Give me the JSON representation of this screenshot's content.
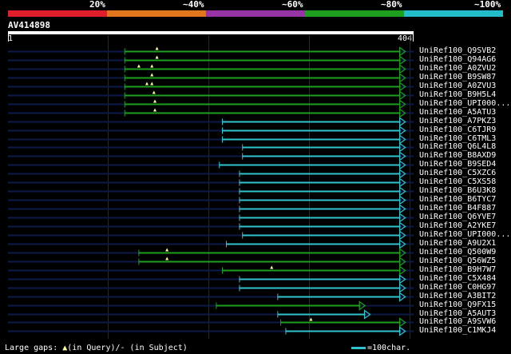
{
  "legend": {
    "labels": [
      "20%",
      "~40%",
      "~60%",
      "~80%",
      "~100%"
    ],
    "colors": [
      "#e01e2c",
      "#e2761f",
      "#9634a6",
      "#1e9e1e",
      "#24bcc8"
    ]
  },
  "query": {
    "name": "AV414898",
    "start_label": "1",
    "end_label": "404",
    "length": 404
  },
  "colors": {
    "green": "#1e9e1e",
    "cyan": "#2fc3d0",
    "gap_marker": "#ffff99",
    "background_line": "#0c1a4a"
  },
  "hits": [
    {
      "label": "UniRef100_Q9SVB2",
      "start": 117,
      "end": 391,
      "color": "green",
      "gaps": [
        149
      ]
    },
    {
      "label": "UniRef100_Q94AG6",
      "start": 117,
      "end": 391,
      "color": "green",
      "gaps": [
        149
      ]
    },
    {
      "label": "UniRef100_A0ZVU2",
      "start": 117,
      "end": 391,
      "color": "green",
      "gaps": [
        131,
        144
      ]
    },
    {
      "label": "UniRef100_B9SW87",
      "start": 117,
      "end": 391,
      "color": "green",
      "gaps": [
        144
      ]
    },
    {
      "label": "UniRef100_A0ZVU3",
      "start": 117,
      "end": 391,
      "color": "green",
      "gaps": [
        139,
        144
      ]
    },
    {
      "label": "UniRef100_B9H5L4",
      "start": 117,
      "end": 391,
      "color": "green",
      "gaps": [
        146
      ]
    },
    {
      "label": "UniRef100_UPI000...",
      "start": 117,
      "end": 391,
      "color": "green",
      "gaps": [
        147
      ]
    },
    {
      "label": "UniRef100_A5ATU3",
      "start": 117,
      "end": 391,
      "color": "green",
      "gaps": [
        147
      ]
    },
    {
      "label": "UniRef100_A7PKZ3",
      "start": 214,
      "end": 391,
      "color": "cyan",
      "gaps": []
    },
    {
      "label": "UniRef100_C6TJR9",
      "start": 214,
      "end": 391,
      "color": "cyan",
      "gaps": []
    },
    {
      "label": "UniRef100_C6TML3",
      "start": 214,
      "end": 391,
      "color": "cyan",
      "gaps": []
    },
    {
      "label": "UniRef100_Q6L4L8",
      "start": 234,
      "end": 391,
      "color": "cyan",
      "gaps": []
    },
    {
      "label": "UniRef100_B8AXD9",
      "start": 234,
      "end": 391,
      "color": "cyan",
      "gaps": []
    },
    {
      "label": "UniRef100_B9SED4",
      "start": 211,
      "end": 391,
      "color": "cyan",
      "gaps": []
    },
    {
      "label": "UniRef100_C5XZC6",
      "start": 231,
      "end": 391,
      "color": "cyan",
      "gaps": []
    },
    {
      "label": "UniRef100_C5XS58",
      "start": 231,
      "end": 391,
      "color": "cyan",
      "gaps": []
    },
    {
      "label": "UniRef100_B6U3K8",
      "start": 231,
      "end": 391,
      "color": "cyan",
      "gaps": []
    },
    {
      "label": "UniRef100_B6TYC7",
      "start": 231,
      "end": 391,
      "color": "cyan",
      "gaps": []
    },
    {
      "label": "UniRef100_B4F887",
      "start": 231,
      "end": 391,
      "color": "cyan",
      "gaps": []
    },
    {
      "label": "UniRef100_Q6YVE7",
      "start": 231,
      "end": 391,
      "color": "cyan",
      "gaps": []
    },
    {
      "label": "UniRef100_A2YKE7",
      "start": 231,
      "end": 391,
      "color": "cyan",
      "gaps": []
    },
    {
      "label": "UniRef100_UPI000...",
      "start": 234,
      "end": 391,
      "color": "cyan",
      "gaps": []
    },
    {
      "label": "UniRef100_A9U2X1",
      "start": 218,
      "end": 391,
      "color": "cyan",
      "gaps": []
    },
    {
      "label": "UniRef100_Q500W9",
      "start": 131,
      "end": 391,
      "color": "green",
      "gaps": [
        159
      ]
    },
    {
      "label": "UniRef100_Q56WZ5",
      "start": 131,
      "end": 391,
      "color": "green",
      "gaps": [
        159
      ]
    },
    {
      "label": "UniRef100_B9H7W7",
      "start": 214,
      "end": 391,
      "color": "green",
      "gaps": [
        263
      ]
    },
    {
      "label": "UniRef100_C5X484",
      "start": 231,
      "end": 391,
      "color": "cyan",
      "gaps": []
    },
    {
      "label": "UniRef100_C0HG97",
      "start": 231,
      "end": 391,
      "color": "cyan",
      "gaps": []
    },
    {
      "label": "UniRef100_A3BIT2",
      "start": 269,
      "end": 391,
      "color": "cyan",
      "gaps": []
    },
    {
      "label": "UniRef100_Q9FX15",
      "start": 208,
      "end": 351,
      "color": "green",
      "gaps": []
    },
    {
      "label": "UniRef100_A5AUT3",
      "start": 269,
      "end": 356,
      "color": "cyan",
      "gaps": []
    },
    {
      "label": "UniRef100_A9SVW6",
      "start": 272,
      "end": 391,
      "color": "green",
      "gaps": [
        302
      ]
    },
    {
      "label": "UniRef100_C1MKJ4",
      "start": 277,
      "end": 391,
      "color": "cyan",
      "gaps": []
    }
  ],
  "footer": {
    "left_prefix": "Large gaps: ",
    "left_suffix": "(in Query)/- (in Subject)",
    "right_label": "=100char."
  }
}
